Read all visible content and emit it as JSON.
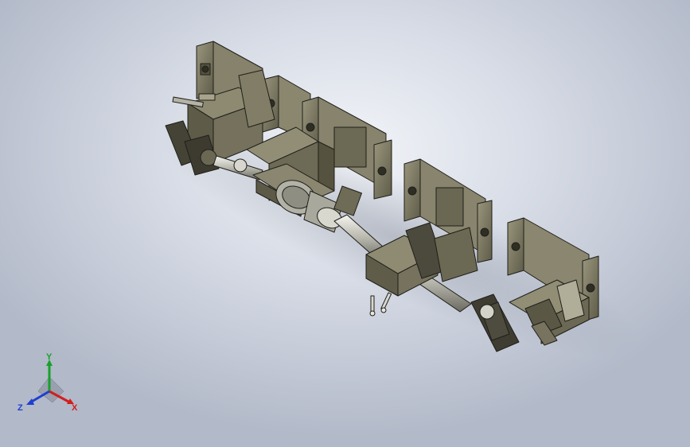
{
  "viewport": {
    "background_center": "#f2f4f8",
    "background_edge": "#b2b9c8"
  },
  "model": {
    "part_color": "#7d7964",
    "part_shadow": "#4a4838",
    "edge_color": "#1f1f1a",
    "shaft_color": "#c9c8c0"
  },
  "triad": {
    "x_label": "X",
    "y_label": "Y",
    "z_label": "Z",
    "x_color": "#d11f1f",
    "y_color": "#17a12b",
    "z_color": "#1f3fd1"
  }
}
